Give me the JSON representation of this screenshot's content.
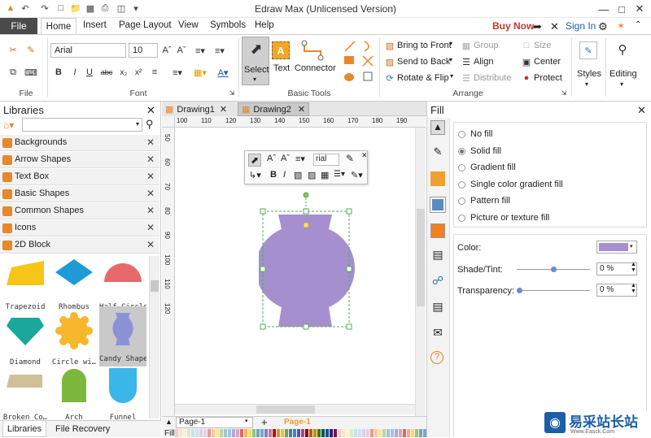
{
  "app": {
    "title": "Edraw Max (Unlicensed Version)",
    "buy_now": "Buy Now",
    "sign_in": "Sign In"
  },
  "menu": {
    "file": "File",
    "items": [
      "Home",
      "Insert",
      "Page Layout",
      "View",
      "Symbols",
      "Help"
    ]
  },
  "ribbon": {
    "font_name": "Arial",
    "font_size": "10",
    "groups": {
      "file": "File",
      "font": "Font",
      "basic_tools": "Basic Tools",
      "arrange": "Arrange"
    },
    "tools": {
      "select": "Select",
      "text": "Text",
      "connector": "Connector"
    },
    "arrange": {
      "bring_to_front": "Bring to Front",
      "send_to_back": "Send to Back",
      "rotate_flip": "Rotate & Flip",
      "group": "Group",
      "align": "Align",
      "distribute": "Distribute",
      "size": "Size",
      "center": "Center",
      "protect": "Protect"
    },
    "styles": "Styles",
    "editing": "Editing"
  },
  "libraries": {
    "title": "Libraries",
    "categories": [
      "Backgrounds",
      "Arrow Shapes",
      "Text Box",
      "Basic Shapes",
      "Common Shapes",
      "Icons",
      "2D Block"
    ],
    "shapes": [
      {
        "label": "Trapezoid",
        "color": "#f5c518"
      },
      {
        "label": "Rhombus",
        "color": "#1e9bd7"
      },
      {
        "label": "Half Circle",
        "color": "#e8696b"
      },
      {
        "label": "Diamond",
        "color": "#1aa79c"
      },
      {
        "label": "Circle wi…",
        "color": "#f8b62d"
      },
      {
        "label": "Candy Shape",
        "color": "#8b93d6"
      },
      {
        "label": "Broken Co…",
        "color": "#cfc09a"
      },
      {
        "label": "Arch",
        "color": "#7cb83b"
      },
      {
        "label": "Funnel",
        "color": "#3ab6e8"
      }
    ],
    "bottom_tabs": [
      "Libraries",
      "File Recovery"
    ]
  },
  "documents": {
    "tabs": [
      "Drawing1",
      "Drawing2"
    ]
  },
  "ruler": {
    "top": [
      "100",
      "110",
      "120",
      "130",
      "140",
      "150",
      "160",
      "170",
      "180",
      "190"
    ],
    "left": [
      "50",
      "60",
      "70",
      "80",
      "90",
      "100",
      "110",
      "120"
    ]
  },
  "mini_toolbar": {
    "font": "rial"
  },
  "canvas_shape": {
    "name": "Candy Shape",
    "fill": "#a68fcf"
  },
  "fill": {
    "title": "Fill",
    "options": [
      "No fill",
      "Solid fill",
      "Gradient fill",
      "Single color gradient fill",
      "Pattern fill",
      "Picture or texture fill"
    ],
    "selected": "Solid fill",
    "color_label": "Color:",
    "color_value": "#a68fcf",
    "shade_label": "Shade/Tint:",
    "shade_value": "0 %",
    "transparency_label": "Transparency:",
    "transparency_value": "0 %"
  },
  "pagebar": {
    "page_select": "Page-1",
    "page_tab": "Page-1",
    "fill_label": "Fill"
  },
  "watermark": {
    "text": "易采站长站",
    "sub": "Www.Easck.Com"
  }
}
